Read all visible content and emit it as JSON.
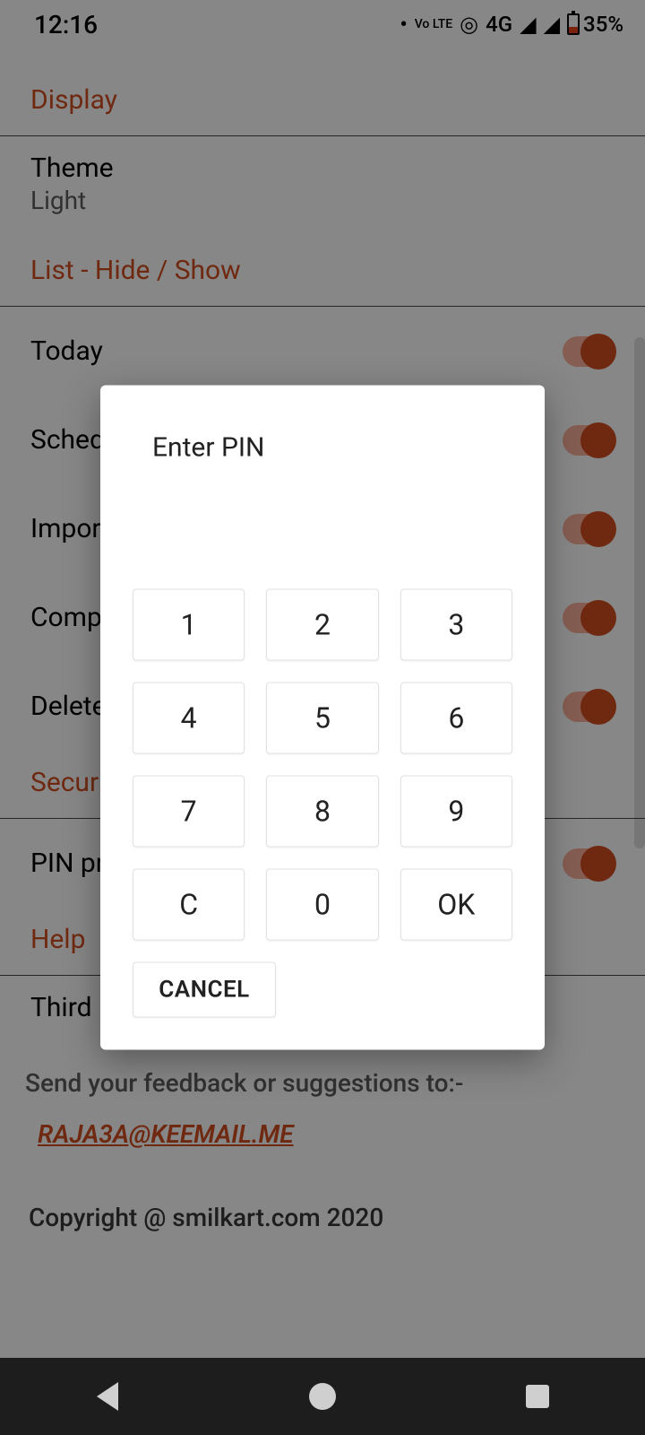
{
  "status": {
    "time": "12:16",
    "volte": "Vo LTE",
    "network": "4G",
    "battery_pct": "35%"
  },
  "sections": {
    "display_header": "Display",
    "theme_label": "Theme",
    "theme_value": "Light",
    "list_header": "List - Hide / Show",
    "security_header": "Security",
    "help_header": "Help"
  },
  "toggles": {
    "today": "Today",
    "scheduled": "Scheduled",
    "important": "Important",
    "completed": "Completed",
    "deleted": "Deleted",
    "pin_protect": "PIN protect"
  },
  "footer": {
    "third_party": "Third party licences",
    "feedback_label": "Send your feedback or suggestions to:-",
    "email": "RAJA3A@KEEMAIL.ME",
    "copyright": "Copyright @ smilkart.com 2020"
  },
  "dialog": {
    "title": "Enter PIN",
    "keys": {
      "k1": "1",
      "k2": "2",
      "k3": "3",
      "k4": "4",
      "k5": "5",
      "k6": "6",
      "k7": "7",
      "k8": "8",
      "k9": "9",
      "kc": "C",
      "k0": "0",
      "kok": "OK"
    },
    "cancel": "CANCEL"
  }
}
